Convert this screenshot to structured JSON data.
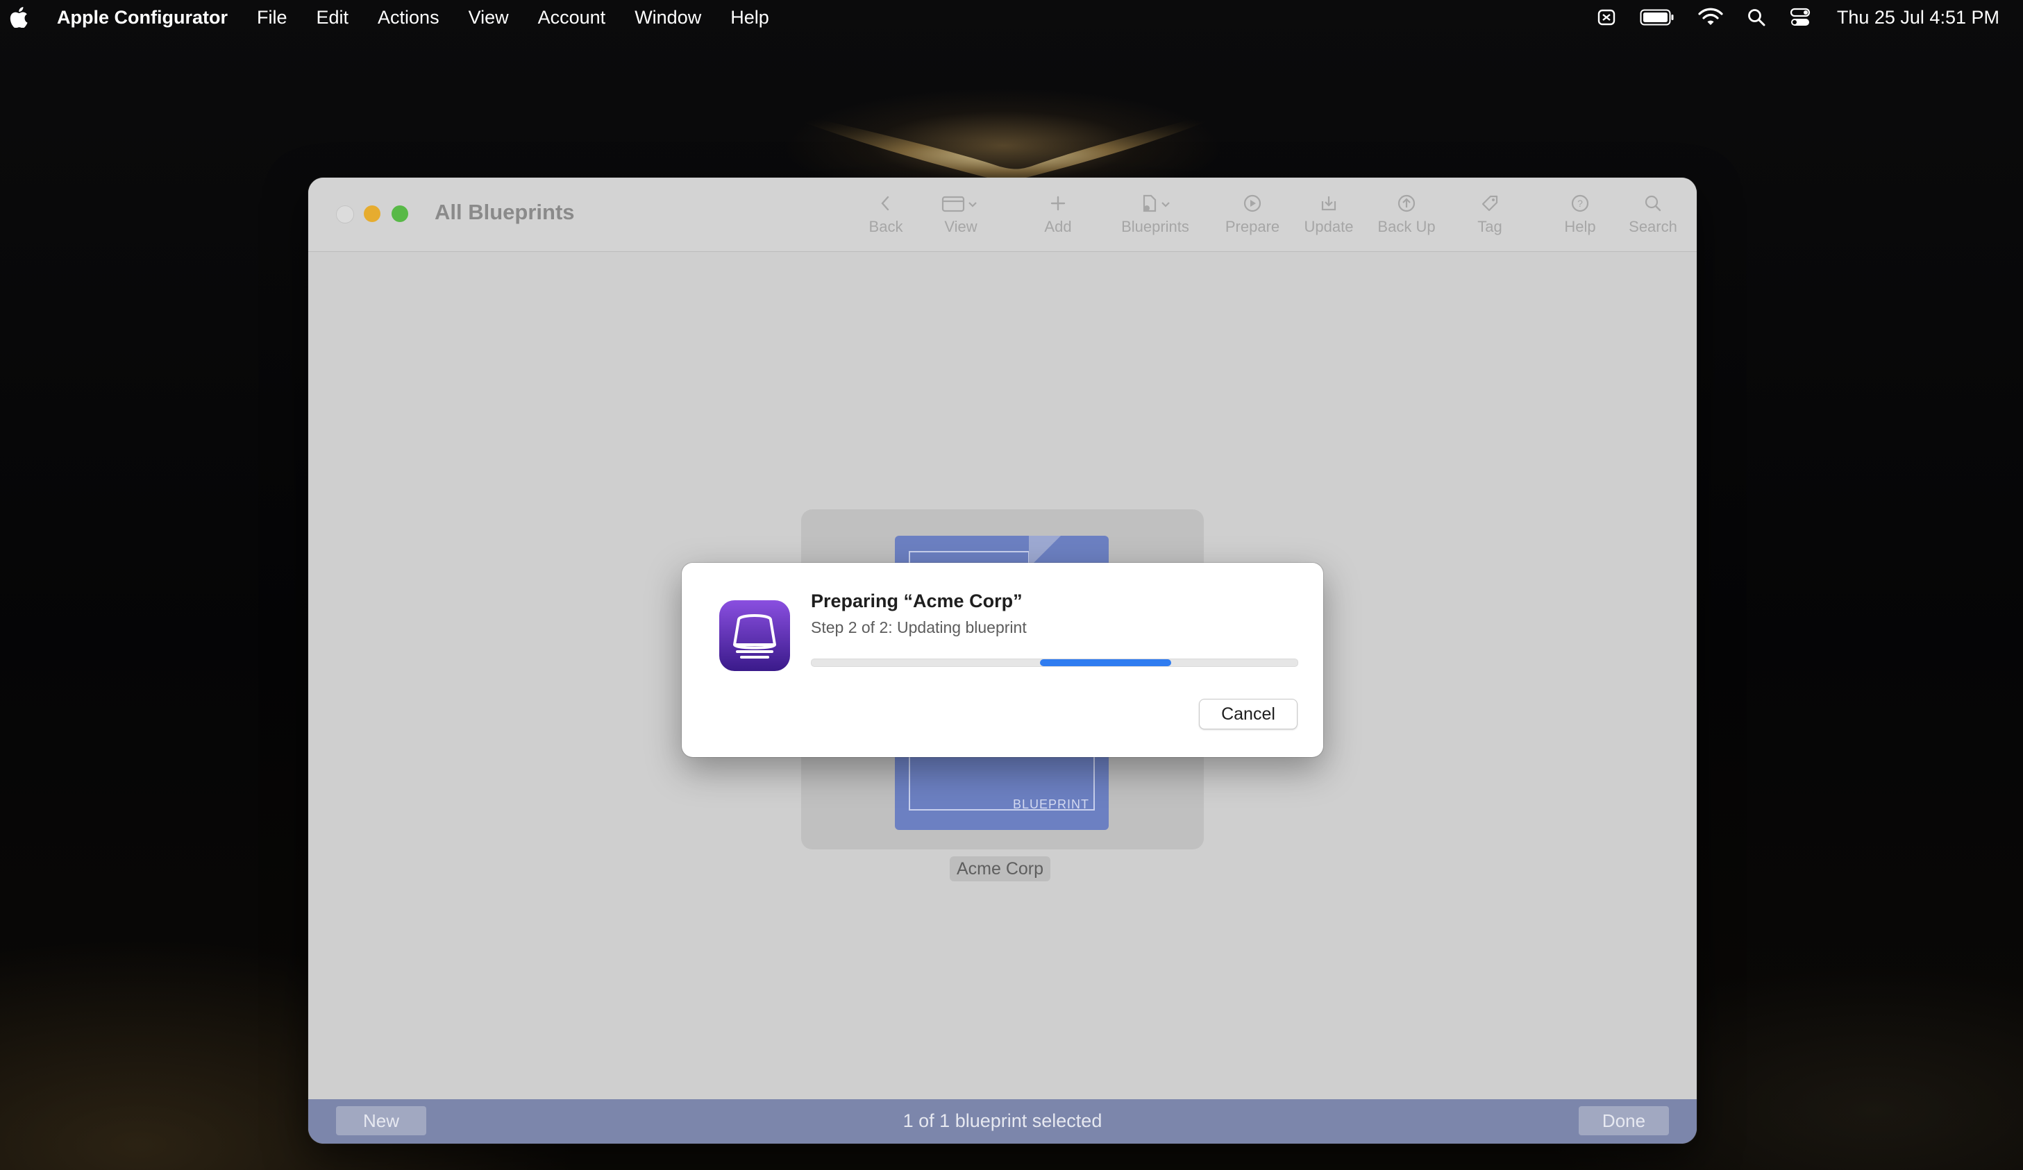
{
  "menubar": {
    "app_name": "Apple Configurator",
    "items": [
      "File",
      "Edit",
      "Actions",
      "View",
      "Account",
      "Window",
      "Help"
    ],
    "clock": "Thu 25 Jul  4:51 PM"
  },
  "window": {
    "title": "All Blueprints",
    "toolbar": {
      "back": "Back",
      "view": "View",
      "add": "Add",
      "blueprints": "Blueprints",
      "prepare": "Prepare",
      "update": "Update",
      "back_up": "Back Up",
      "tag": "Tag",
      "help": "Help",
      "search": "Search"
    },
    "blueprint": {
      "name": "Acme Corp",
      "label": "BLUEPRINT"
    },
    "bottom_bar": {
      "new_label": "New",
      "status": "1 of 1 blueprint selected",
      "done_label": "Done"
    }
  },
  "dialog": {
    "title": "Preparing “Acme Corp”",
    "subtitle": "Step 2 of 2: Updating blueprint",
    "progress": {
      "start": 0.47,
      "end": 0.74
    },
    "cancel_label": "Cancel"
  },
  "colors": {
    "accent": "#2f7cf0",
    "app_icon": "#5b2bb0",
    "bottom_bar": "#7c86ab",
    "blueprint": "#6c80c2"
  }
}
